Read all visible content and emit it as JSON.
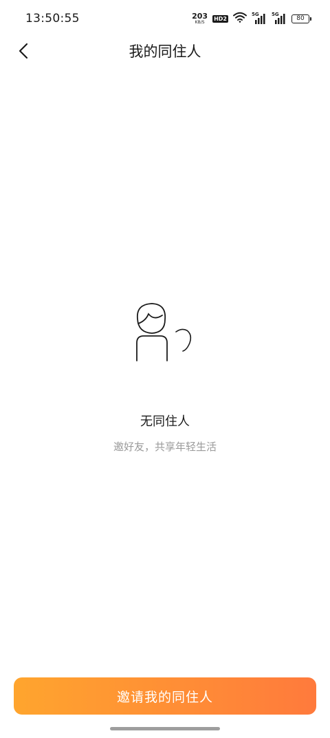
{
  "status_bar": {
    "time": "13:50:55",
    "net_speed_value": "203",
    "net_speed_unit": "KB/S",
    "hd_label": "HD2",
    "signal_1_gen": "5G",
    "signal_2_gen": "5G",
    "battery_level": "80"
  },
  "nav": {
    "title": "我的同住人"
  },
  "empty_state": {
    "title": "无同住人",
    "subtitle": "邀好友，共享年轻生活"
  },
  "bottom": {
    "invite_label": "邀请我的同住人"
  },
  "colors": {
    "button_gradient_start": "#ffa52e",
    "button_gradient_end": "#ff7a3c",
    "subtitle_text": "#9a9a9a"
  }
}
